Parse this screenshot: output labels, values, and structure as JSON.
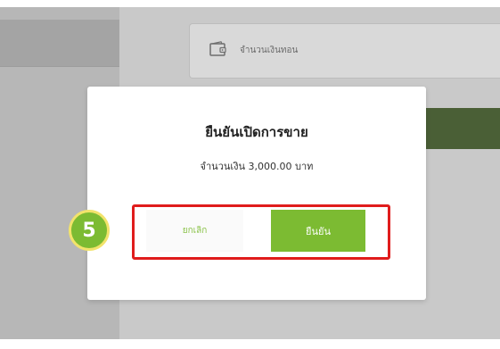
{
  "background": {
    "card_label": "จำนวนเงินทอน",
    "card_icon": "wallet-icon"
  },
  "dialog": {
    "title": "ยืนยันเปิดการขาย",
    "amount_text": "จำนวนเงิน 3,000.00 บาท",
    "cancel_label": "ยกเลิก",
    "confirm_label": "ยืนยัน"
  },
  "annotation": {
    "step_number": "5",
    "highlight_color": "#e01c1c"
  },
  "colors": {
    "accent": "#7cbb32",
    "badge_border": "#f2e36b"
  }
}
